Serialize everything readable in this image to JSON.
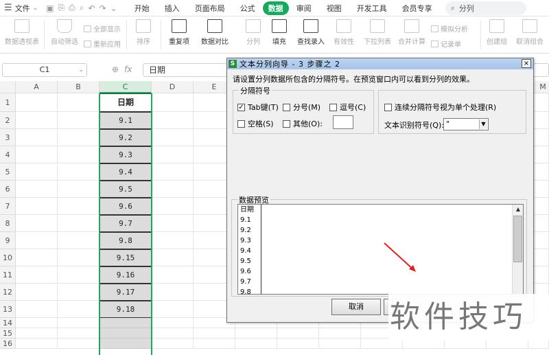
{
  "menubar": {
    "file_label": "文件",
    "tabs": [
      "开始",
      "插入",
      "页面布局",
      "公式",
      "数据",
      "审阅",
      "视图",
      "开发工具",
      "会员专享"
    ],
    "active_tab": "数据",
    "search_text": "分列",
    "accent_color": "#1aa85e"
  },
  "ribbon": {
    "pivot": "数据透视表",
    "autofilter": "自动筛选",
    "show_all": "全部显示",
    "reapply": "重新应用",
    "sort": "排序",
    "duplicates": "重复项",
    "compare": "数据对比",
    "split": "分列",
    "fill": "填充",
    "lookup_entry": "查找录入",
    "validity": "有效性",
    "dropdown": "下拉列表",
    "consolidate": "合并计算",
    "simulate": "模拟分析",
    "record": "记录单",
    "create_group": "创建组",
    "ungroup": "取消组合"
  },
  "formula_bar": {
    "cell_ref": "C1",
    "fx": "fx",
    "content": "日期"
  },
  "sheet": {
    "columns": [
      "A",
      "B",
      "C",
      "D",
      "E"
    ],
    "partial_column": "M",
    "rows": [
      "1",
      "2",
      "3",
      "4",
      "5",
      "6",
      "7",
      "8",
      "9",
      "10",
      "11",
      "12",
      "13",
      "14",
      "15",
      "16"
    ],
    "column_c": [
      "日期",
      "9.1",
      "9.2",
      "9.3",
      "9.4",
      "9.5",
      "9.6",
      "9.7",
      "9.8",
      "9.15",
      "9.16",
      "9.17",
      "9.18"
    ]
  },
  "dialog": {
    "title": "文本分列向导 - 3 步骤之 2",
    "app_icon": "S",
    "close": "×",
    "description": "请设置分列数据所包含的分隔符号。在预览窗口内可以看到分列的效果。",
    "delimiter_group": "分隔符号",
    "tab_label": "Tab键(T)",
    "tab_checked": "✓",
    "semicolon_label": "分号(M)",
    "comma_label": "逗号(C)",
    "space_label": "空格(S)",
    "other_label": "其他(O):",
    "consecutive_label": "连续分隔符号视为单个处理(R)",
    "qualifier_label": "文本识别符号(Q):",
    "qualifier_value": "\"",
    "preview_title": "数据预览",
    "preview_lines": [
      "日期",
      "9.1",
      "9.2",
      "9.3",
      "9.4",
      "9.5",
      "9.6",
      "9.7",
      "9.8"
    ],
    "cancel": "取消"
  },
  "watermark": "软件技巧"
}
